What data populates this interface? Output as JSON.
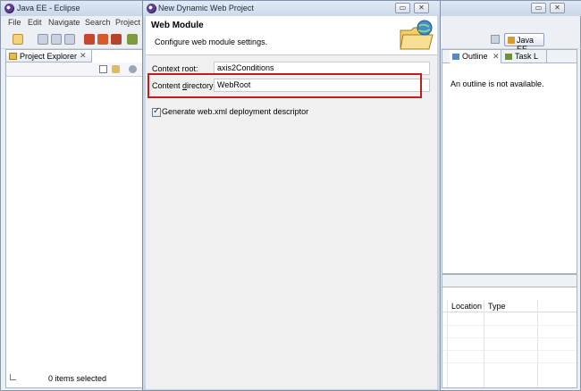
{
  "app": {
    "title": "Java EE - Eclipse",
    "menu": [
      "File",
      "Edit",
      "Navigate",
      "Search",
      "Project"
    ],
    "window_buttons": [
      "▭",
      "✕"
    ]
  },
  "perspective": {
    "label": "Java EE"
  },
  "project_explorer": {
    "tab_label": "Project Explorer",
    "tab_close": "✕",
    "status": "0 items selected"
  },
  "outline": {
    "tabs": [
      {
        "label": "Outline",
        "close": "✕"
      },
      {
        "label": "Task L"
      }
    ],
    "message": "An outline is not available."
  },
  "bottom_panel": {
    "columns": [
      "Location",
      "Type"
    ]
  },
  "dialog": {
    "title": "New Dynamic Web Project",
    "window_buttons": [
      "▭",
      "✕"
    ],
    "heading": "Web Module",
    "description": "Configure web module settings.",
    "fields": [
      {
        "label": "Context root:",
        "value": "axis2Conditions"
      },
      {
        "label_pre": "Content ",
        "label_u": "d",
        "label_post": "irectory:",
        "value": "WebRoot"
      }
    ],
    "checkbox": {
      "label": "Generate web.xml deployment descriptor",
      "checked": true
    }
  },
  "colors": {
    "highlight": "#c21d1d",
    "title_bar": "#cbd9ea",
    "dialog_body": "#f0f0f0"
  }
}
